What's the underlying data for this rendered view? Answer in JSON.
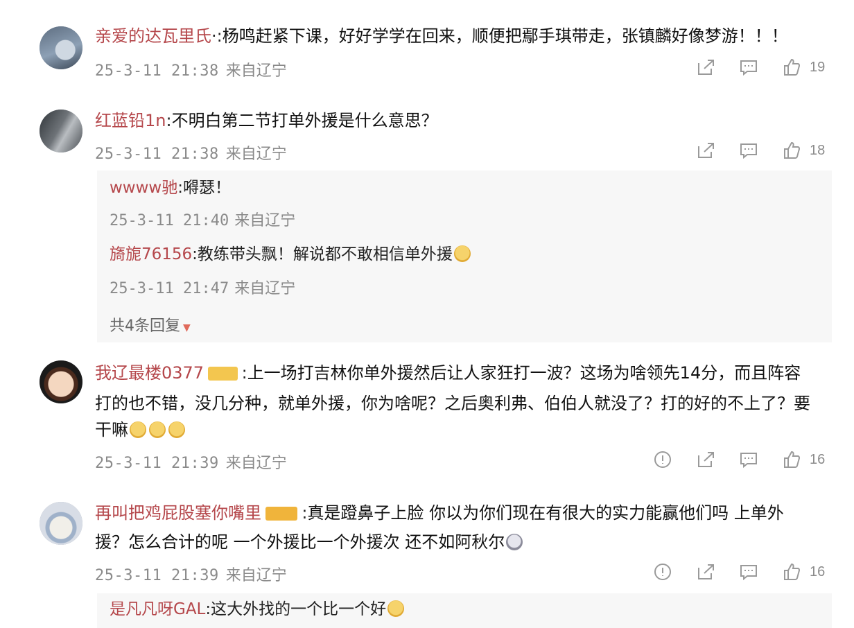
{
  "comments": [
    {
      "username": "亲爱的达瓦里氏",
      "separator": "·:",
      "text": "杨鸣赶紧下课，好好学学在回来，顺便把鄢手琪带走，张镇麟好像梦游！！！",
      "time": "25-3-11 21:38",
      "location": "来自辽宁",
      "likes": "19"
    },
    {
      "username": "红蓝铅1n",
      "separator": ":",
      "text": "不明白第二节打单外援是什么意思？",
      "time": "25-3-11 21:38",
      "location": "来自辽宁",
      "likes": "18",
      "replies": [
        {
          "username": "wwww驰",
          "separator": ":",
          "text": "嘚瑟！",
          "time": "25-3-11 21:40",
          "location": "来自辽宁"
        },
        {
          "username": "旖旎76156",
          "separator": ":",
          "text": "教练带头飘！解说都不敢相信单外援",
          "time": "25-3-11 21:47",
          "location": "来自辽宁"
        }
      ],
      "more_replies": "共4条回复"
    },
    {
      "username": "我辽最楼0377",
      "separator": ":",
      "text_line1": "上一场打吉林你单外援然后让人家狂打一波？这场为啥领先14分，而且阵容",
      "text_line2": "打的也不错，没几分种，就单外援，你为啥呢？之后奥利弗、伯伯人就没了？打的好的不上了？要",
      "text_line3": "干嘛",
      "time": "25-3-11 21:39",
      "location": "来自辽宁",
      "likes": "16"
    },
    {
      "username": "再叫把鸡屁股塞你嘴里",
      "separator": ":",
      "text_line1": "真是蹬鼻子上脸 你以为你们现在有很大的实力能赢他们吗 上单外",
      "text_line2": "援？怎么合计的呢 一个外援比一个外援次 还不如阿秋尔",
      "time": "25-3-11 21:39",
      "location": "来自辽宁",
      "likes": "16",
      "replies": [
        {
          "username": "是凡凡呀GAL",
          "separator": ":",
          "text": "这大外找的一个比一个好"
        }
      ]
    }
  ],
  "colors": {
    "username": "#b5474b",
    "meta": "#8a8a8a",
    "reply_bg": "#f7f7f7"
  },
  "icons": [
    "share-icon",
    "comment-icon",
    "like-icon",
    "report-icon"
  ]
}
